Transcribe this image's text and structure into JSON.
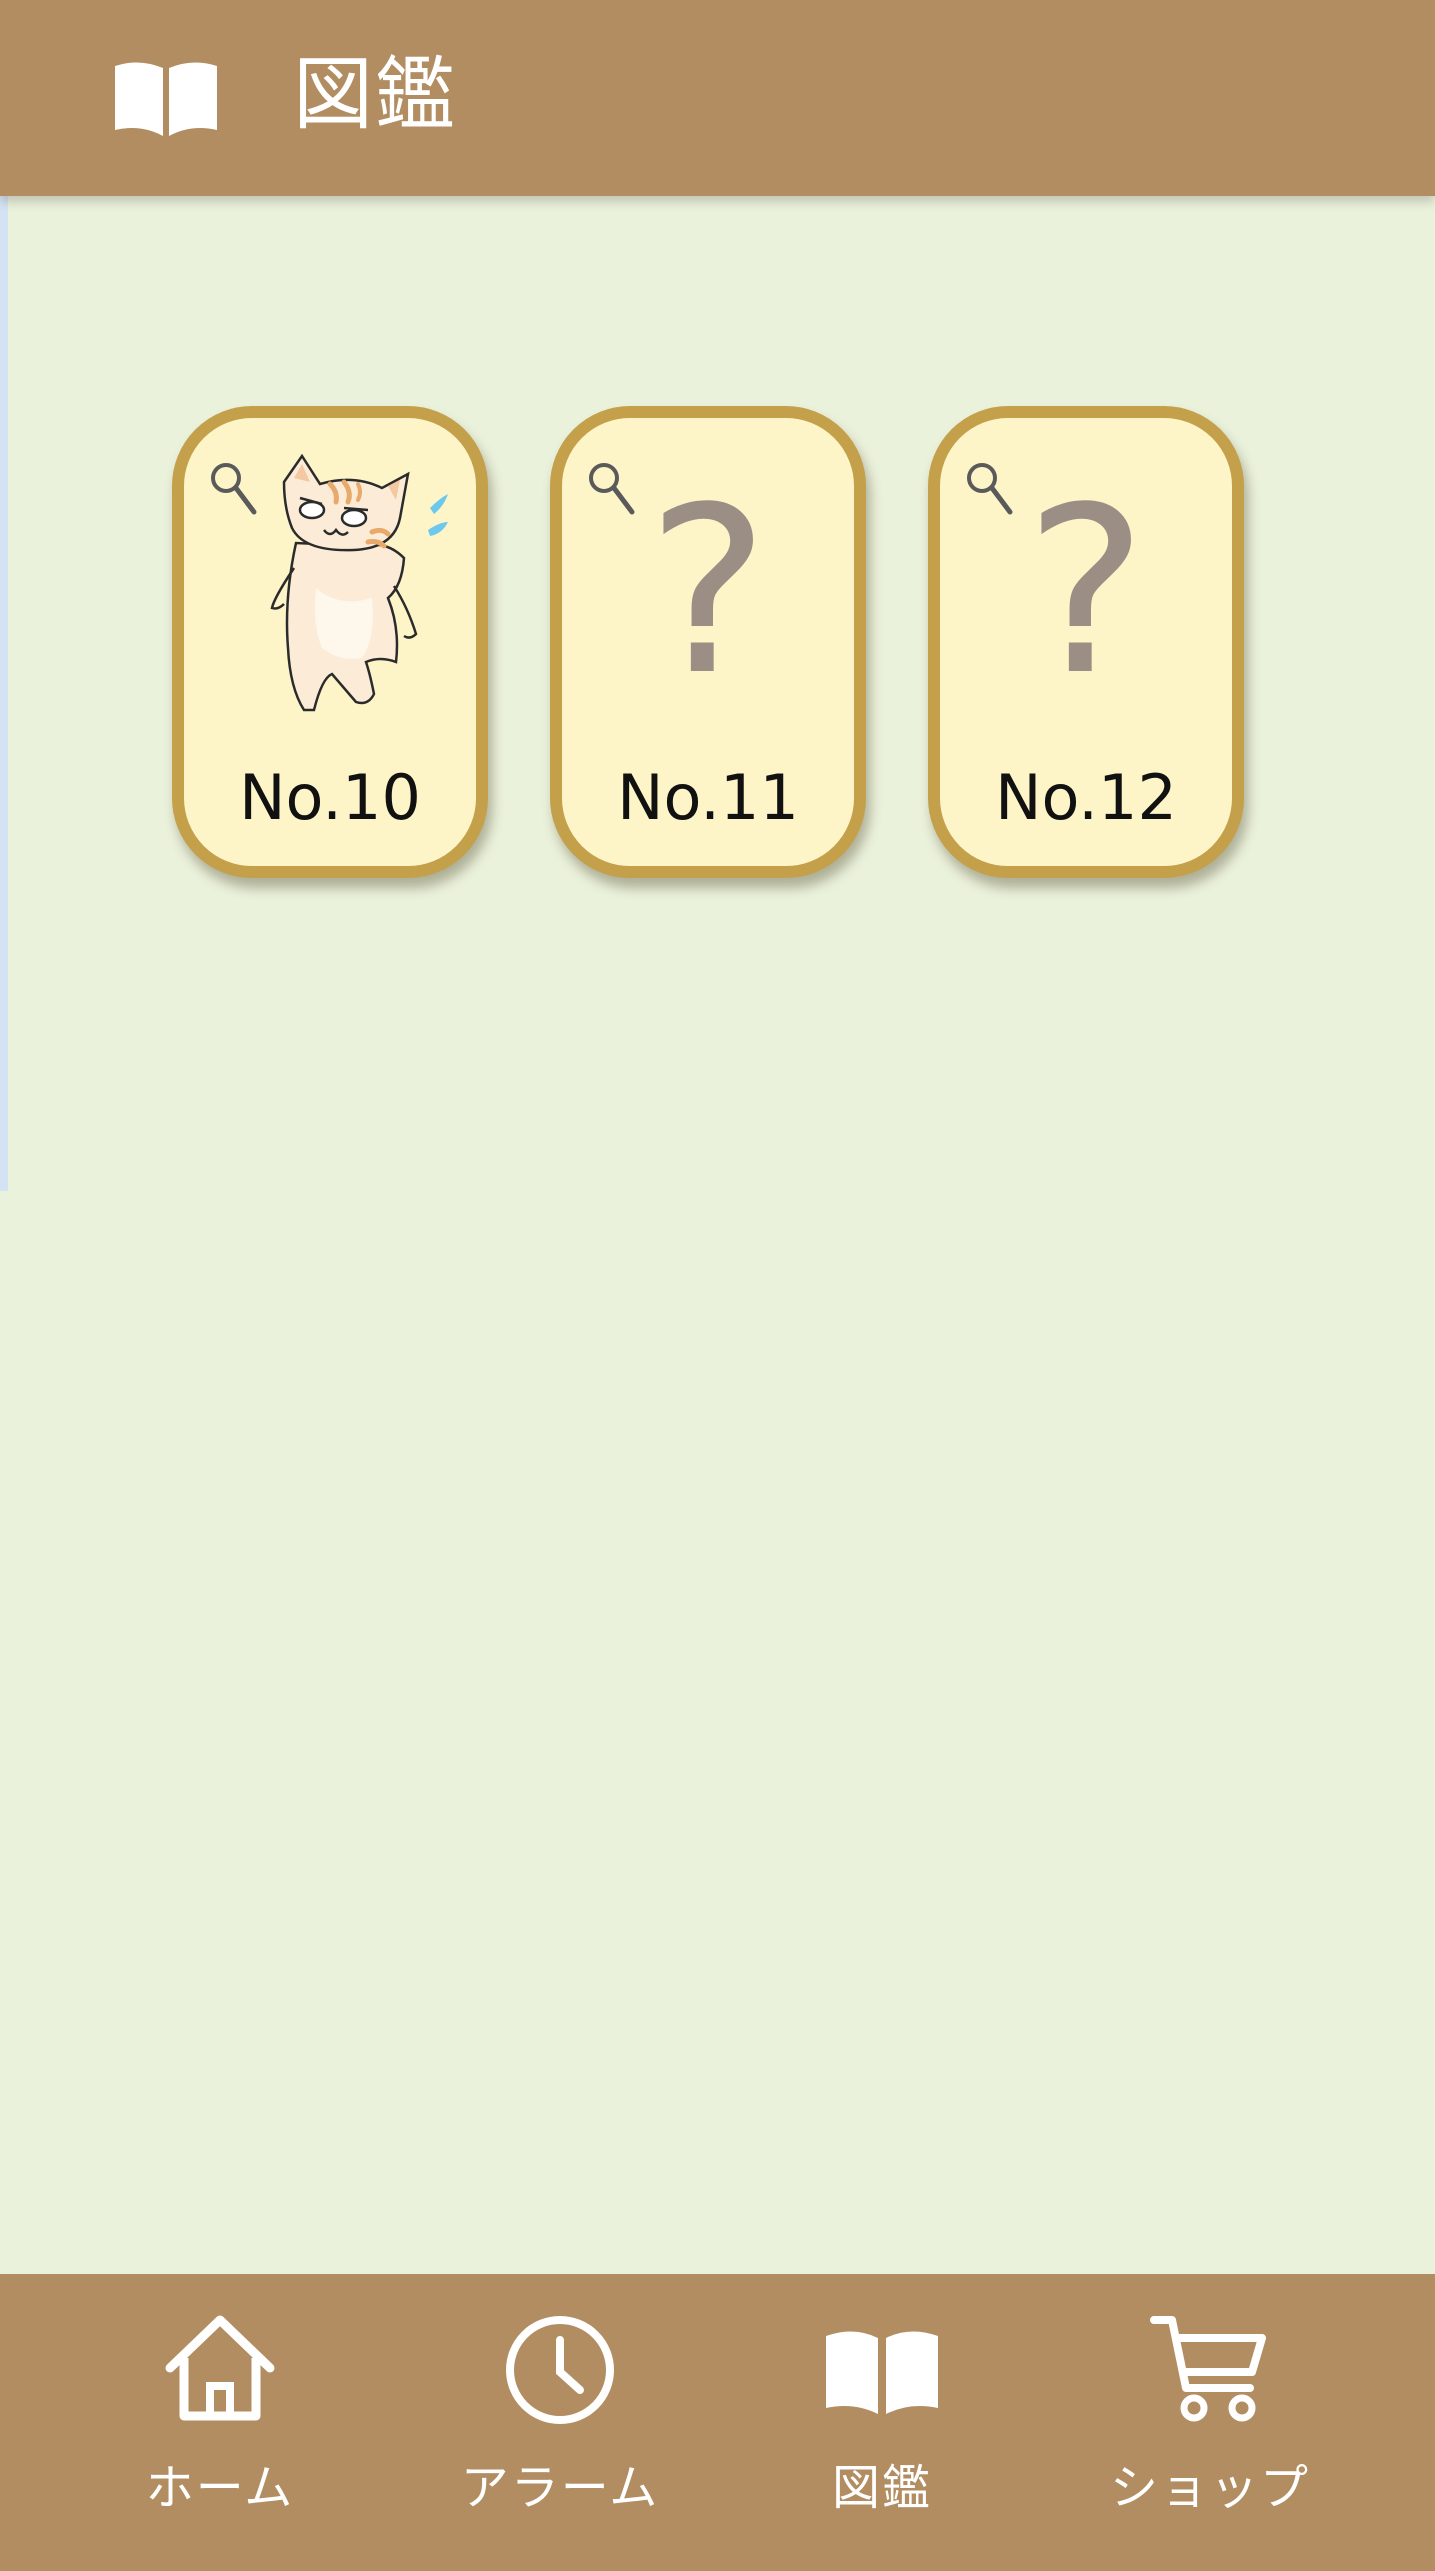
{
  "header": {
    "title": "図鑑",
    "icon": "open-book-icon"
  },
  "cards": [
    {
      "number": "No.10",
      "state": "discovered",
      "image": "cat-illustration",
      "icon": "magnifier-icon"
    },
    {
      "number": "No.11",
      "state": "unknown",
      "placeholder": "?",
      "icon": "magnifier-icon"
    },
    {
      "number": "No.12",
      "state": "unknown",
      "placeholder": "?",
      "icon": "magnifier-icon"
    }
  ],
  "nav": {
    "items": [
      {
        "label": "ホーム",
        "icon": "home-icon"
      },
      {
        "label": "アラーム",
        "icon": "clock-icon"
      },
      {
        "label": "図鑑",
        "icon": "open-book-icon"
      },
      {
        "label": "ショップ",
        "icon": "cart-icon"
      }
    ]
  },
  "colors": {
    "bar": "#b28d61",
    "background": "#ebf2dc",
    "card_fill": "#fdf5c8",
    "card_border": "#c4a04b",
    "placeholder": "#9b8f85"
  }
}
